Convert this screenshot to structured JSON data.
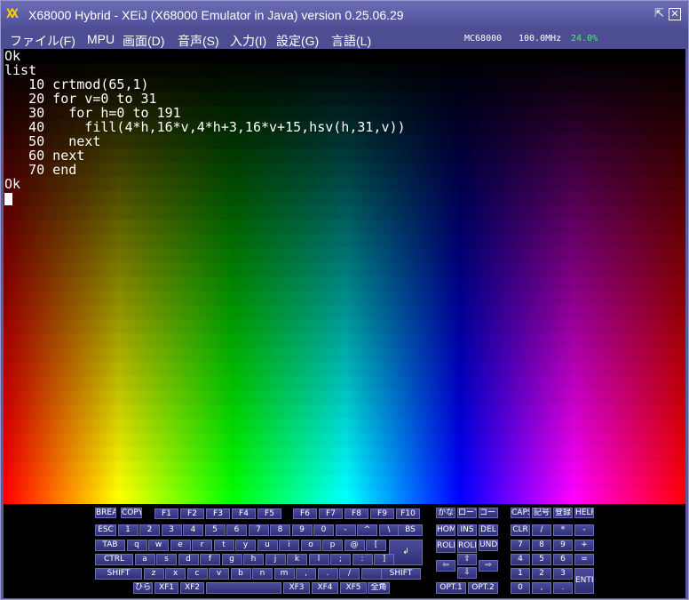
{
  "window": {
    "title": "X68000 Hybrid - XEiJ (X68000 Emulator in Java) version 0.25.06.29",
    "logo": "XX",
    "restore_glyph": "⇱",
    "close_glyph": "✕"
  },
  "menu": {
    "items": [
      "ファイル(F)",
      "MPU",
      "画面(D)",
      "音声(S)",
      "入力(I)",
      "設定(G)",
      "言語(L)"
    ]
  },
  "status": {
    "cpu": "MC68000",
    "clock": "100.0MHz",
    "load": "24.0%",
    "load_color": "#33ff66"
  },
  "console": {
    "lines": [
      "Ok",
      "list",
      "   10 crtmod(65,1)",
      "   20 for v=0 to 31",
      "   30   for h=0 to 191",
      "   40     fill(4*h,16*v,4*h+3,16*v+15,hsv(h,31,v))",
      "   50   next",
      "   60 next",
      "   70 end",
      "Ok"
    ]
  },
  "keyboard": {
    "row0": [
      "BREAK",
      "COPY",
      "F1",
      "F2",
      "F3",
      "F4",
      "F5",
      "F6",
      "F7",
      "F8",
      "F9",
      "F10",
      "かな",
      "ローマ",
      "コード",
      "CAPS",
      "記号",
      "登録",
      "HELP"
    ],
    "row1": [
      "ESC",
      "1",
      "2",
      "3",
      "4",
      "5",
      "6",
      "7",
      "8",
      "9",
      "0",
      "-",
      "^",
      "\\",
      "BS",
      "HOME",
      "INS",
      "DEL",
      "CLR",
      "/",
      "*",
      "-"
    ],
    "row2": [
      "TAB",
      "q",
      "w",
      "e",
      "r",
      "t",
      "y",
      "u",
      "i",
      "o",
      "p",
      "@",
      "[",
      "ROLL UP",
      "ROLL DOWN",
      "UNDO",
      "7",
      "8",
      "9",
      "+"
    ],
    "row3": [
      "CTRL",
      "a",
      "s",
      "d",
      "f",
      "g",
      "h",
      "j",
      "k",
      "l",
      ";",
      ":",
      "]",
      "4",
      "5",
      "6",
      "="
    ],
    "row4": [
      "SHIFT",
      "z",
      "x",
      "c",
      "v",
      "b",
      "n",
      "m",
      ",",
      ".",
      "/",
      "",
      "SHIFT",
      "1",
      "2",
      "3"
    ],
    "row5": [
      "ひら",
      "XF1",
      "XF2",
      "",
      "XF3",
      "XF4",
      "XF5",
      "全角",
      "OPT.1",
      "OPT.2",
      "0",
      ",",
      "."
    ],
    "enter": "↲",
    "arrows": [
      "⇧",
      "⇦",
      "⇨",
      "⇩"
    ],
    "numpad_enter": "ENTER"
  }
}
